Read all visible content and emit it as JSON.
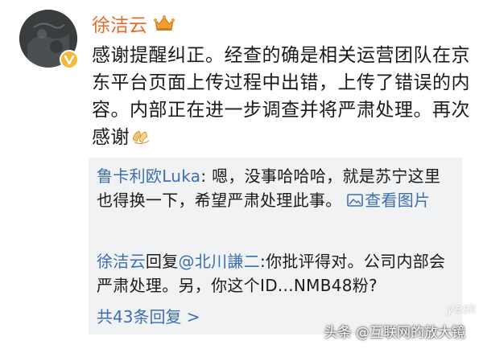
{
  "post": {
    "username": "徐洁云",
    "text_main": "感谢提醒纠正。经查的确是相关运营团队在京东平台页面上传过程中出错，上传了错误的内容。内部正在进一步调查并将严肃处理。再次感谢",
    "icons": {
      "avatar": "avatar-image",
      "verified": "verified-badge-icon",
      "crown": "crown-icon",
      "emoji": "clapping-hands-emoji"
    }
  },
  "replies": [
    {
      "author": "鲁卡利欧Luka",
      "separator": ": ",
      "text": "嗯，没事哈哈哈，就是苏宁这里也得换一下，希望严肃处理此事。",
      "picture_label": "查看图片"
    },
    {
      "author": "徐洁云",
      "action": "回复",
      "mention": "@北川謙二",
      "separator": ":",
      "text": "你批评得对。公司内部会严肃处理。另，你这个ID...NMB48粉?"
    }
  ],
  "more_replies": "共43条回复 >",
  "watermark": "头条 @互联网的放大镜",
  "corner_mark": "yesk",
  "colors": {
    "username": "#e86a2c",
    "link": "#3d6fb0",
    "reply_bg": "#f1f2f4",
    "badge": "#f6b93b"
  }
}
